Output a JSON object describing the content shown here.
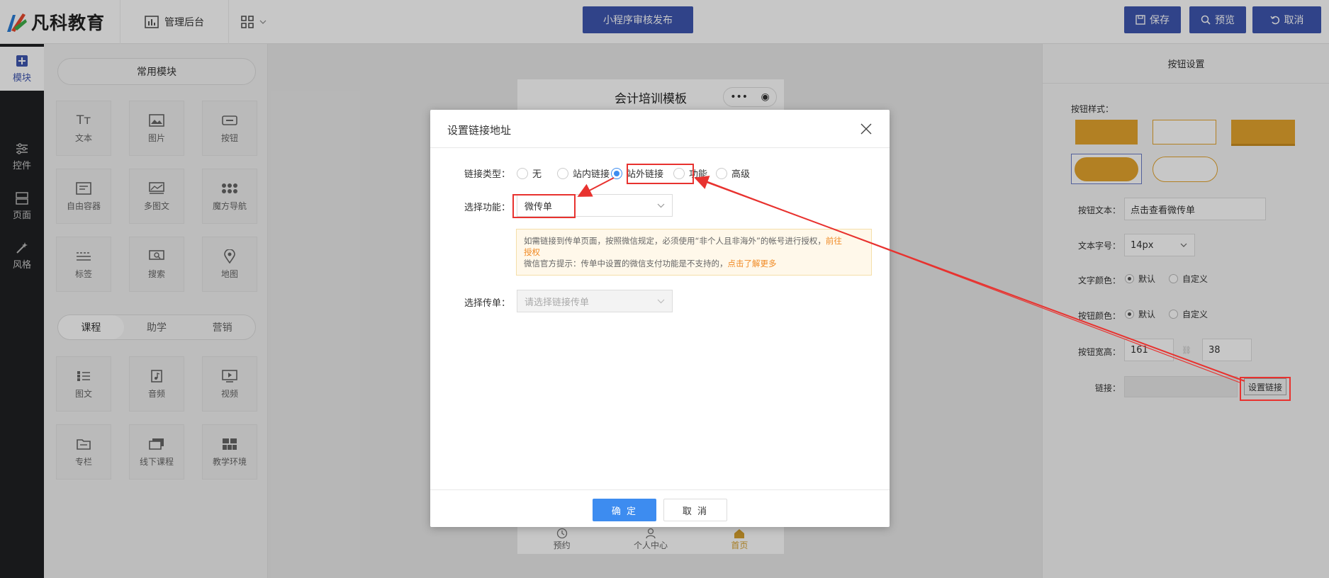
{
  "brand": {
    "name": "凡科教育"
  },
  "topbar": {
    "admin_label": "管理后台",
    "publish_label": "小程序审核发布",
    "save_label": "保存",
    "preview_label": "预览",
    "cancel_label": "取消"
  },
  "leftnav": {
    "items": [
      {
        "label": "模块",
        "icon": "plus-square-icon"
      },
      {
        "label": "控件",
        "icon": "sliders-icon"
      },
      {
        "label": "页面",
        "icon": "layout-icon"
      },
      {
        "label": "风格",
        "icon": "magic-wand-icon"
      }
    ]
  },
  "modules": {
    "common_label": "常用模块",
    "common": [
      "文本",
      "图片",
      "按钮",
      "自由容器",
      "多图文",
      "魔方导航",
      "标签",
      "搜索",
      "地图"
    ],
    "tabs": [
      "课程",
      "助学",
      "营销"
    ],
    "course": [
      "图文",
      "音频",
      "视频",
      "专栏",
      "线下课程",
      "教学环境"
    ]
  },
  "phone": {
    "title": "会计培训模板",
    "tabbar": [
      "预约",
      "个人中心",
      "首页"
    ]
  },
  "settings": {
    "title": "按钮设置",
    "style_label": "按钮样式：",
    "text_label": "按钮文本：",
    "text_value": "点击查看微传单",
    "font_label": "文本字号：",
    "font_value": "14px",
    "text_color_label": "文字颜色：",
    "btn_color_label": "按钮颜色：",
    "default_label": "默认",
    "custom_label": "自定义",
    "size_label": "按钮宽高：",
    "width_value": "161",
    "height_value": "38",
    "link_label": "链接：",
    "link_button": "设置链接",
    "accent": "#e5a52e"
  },
  "dialog": {
    "title": "设置链接地址",
    "link_type_label": "链接类型：",
    "link_types": [
      "无",
      "站内链接",
      "站外链接",
      "功能",
      "高级"
    ],
    "selected_type": "站外链接",
    "func_label": "选择功能：",
    "func_value": "微传单",
    "notice_line1": "如需链接到传单页面，按照微信规定，必须使用“非个人且非海外”的帐号进行授权，",
    "notice_link1a": "前往",
    "notice_link1b": "授权",
    "notice_line2": "微信官方提示：传单中设置的微信支付功能是不支持的，",
    "notice_link2": "点击了解更多",
    "flyer_label": "选择传单：",
    "flyer_placeholder": "请选择链接传单",
    "ok_label": "确 定",
    "cancel_label": "取 消"
  },
  "colors": {
    "primary": "#3e56b0",
    "dialog_blue": "#3d8cf0",
    "annotation": "#e8322f"
  }
}
